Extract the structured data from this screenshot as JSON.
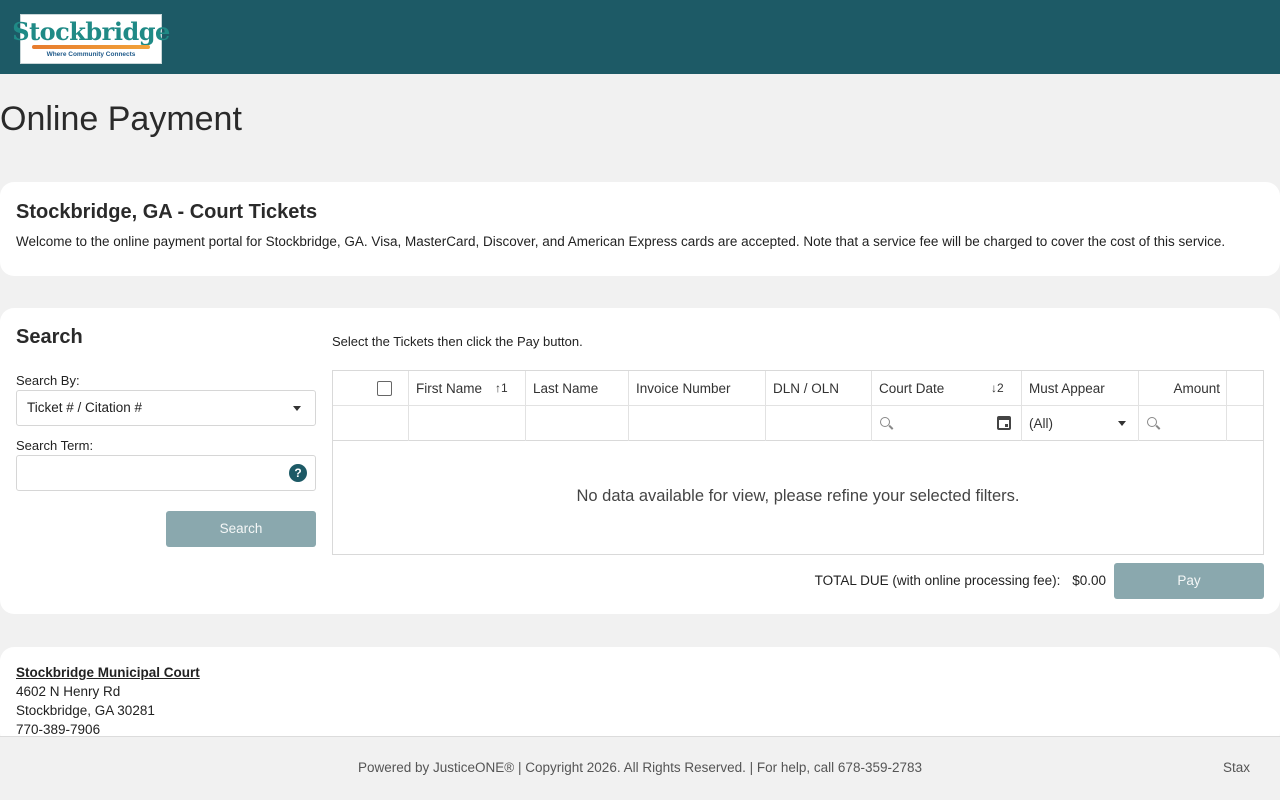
{
  "header": {
    "logo": {
      "word": "Stockbridge",
      "tagline": "Where Community Connects"
    }
  },
  "page_title": "Online Payment",
  "intro": {
    "title": "Stockbridge, GA - Court Tickets",
    "description": "Welcome to the online payment portal for Stockbridge, GA. Visa, MasterCard, Discover, and American Express cards are accepted. Note that a service fee will be charged to cover the cost of this service."
  },
  "search": {
    "title": "Search",
    "search_by_label": "Search By:",
    "search_by_value": "Ticket # / Citation #",
    "search_term_label": "Search Term:",
    "search_term_value": "",
    "help_glyph": "?",
    "button_label": "Search"
  },
  "grid": {
    "instructions": "Select the Tickets then click the Pay button.",
    "columns": {
      "first_name": "First Name",
      "first_name_sort": "1",
      "last_name": "Last Name",
      "invoice_number": "Invoice Number",
      "dln_oln": "DLN / OLN",
      "court_date": "Court Date",
      "court_date_sort": "2",
      "must_appear": "Must Appear",
      "amount": "Amount"
    },
    "filters": {
      "must_appear_value": "(All)"
    },
    "empty_message": "No data available for view, please refine your selected filters."
  },
  "totals": {
    "label": "TOTAL DUE (with online processing fee):",
    "amount": "$0.00",
    "pay_label": "Pay"
  },
  "court": {
    "name": "Stockbridge Municipal Court",
    "address1": "4602 N Henry Rd",
    "address2": "Stockbridge, GA 30281",
    "phone": "770-389-7906"
  },
  "footer": {
    "text": "Powered by JusticeONE® | Copyright 2026. All Rights Reserved. | For help, call 678-359-2783",
    "link": "Stax"
  },
  "colors": {
    "header": "#1d5a66",
    "button_disabled": "#8aa8ae",
    "background": "#f1f1f1"
  }
}
